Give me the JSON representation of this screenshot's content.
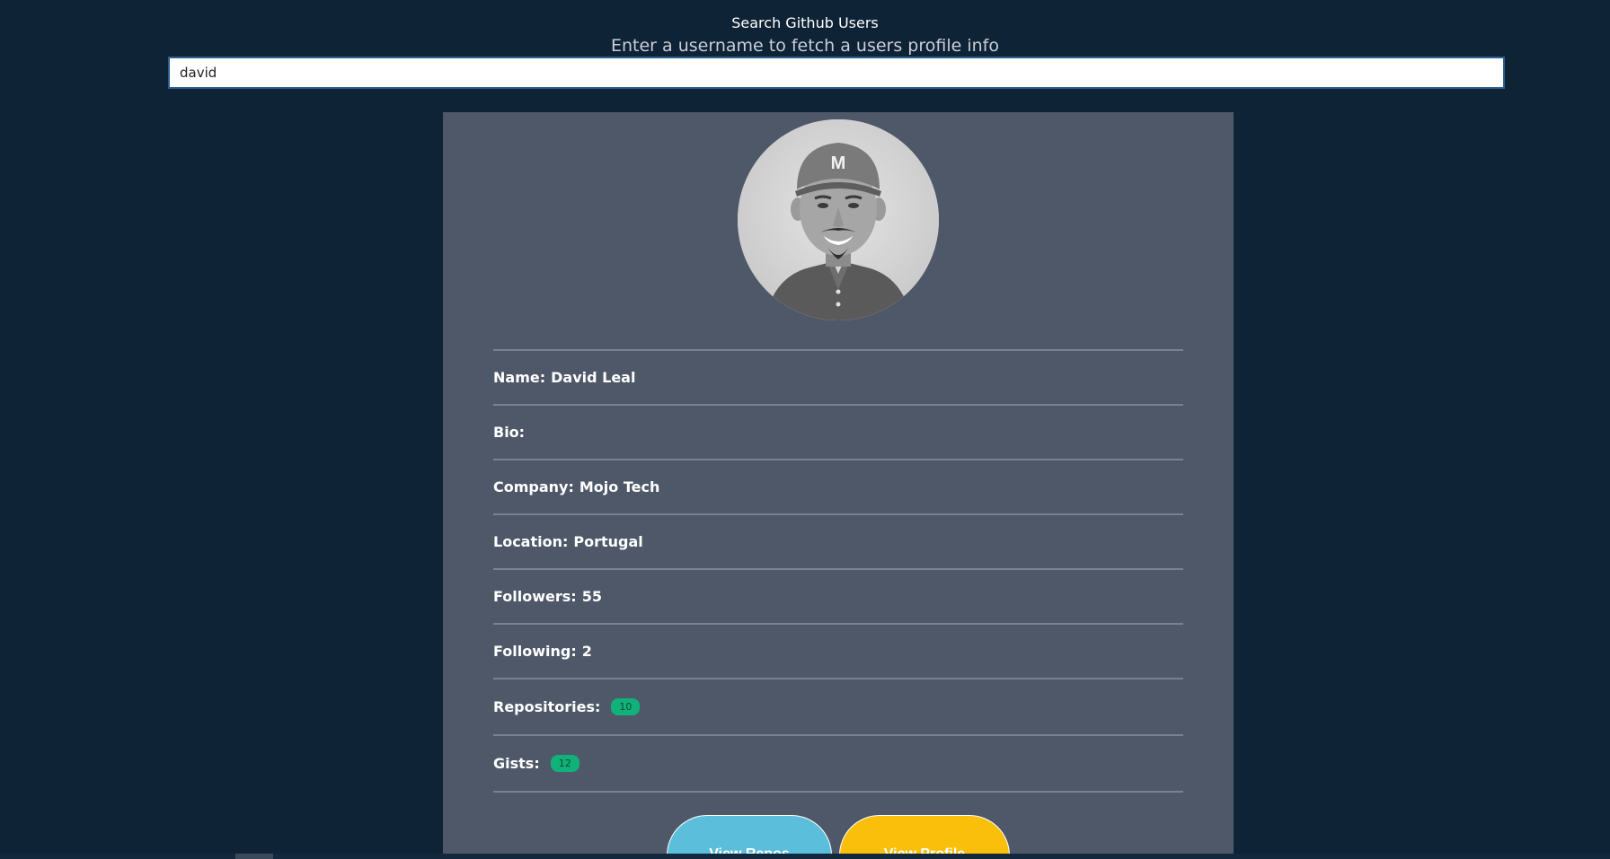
{
  "header": {
    "title": "Search Github Users",
    "subtitle": "Enter a username to fetch a users profile info"
  },
  "search": {
    "value": "david",
    "placeholder": ""
  },
  "profile": {
    "avatar_icon": "avatar-photo",
    "fields": [
      {
        "label": "Name:",
        "value": "David Leal"
      },
      {
        "label": "Bio:",
        "value": ""
      },
      {
        "label": "Company:",
        "value": "Mojo Tech"
      },
      {
        "label": "Location:",
        "value": "Portugal"
      },
      {
        "label": "Followers:",
        "value": "55"
      },
      {
        "label": "Following:",
        "value": "2"
      }
    ],
    "repositories": {
      "label": "Repositories:",
      "count": "10"
    },
    "gists": {
      "label": "Gists:",
      "count": "12"
    }
  },
  "actions": {
    "view_repos_label": "View Repos",
    "view_profile_label": "View Profile"
  },
  "colors": {
    "background": "#0f2336",
    "card": "#4e5868",
    "badge": "#10b27a",
    "repos_button": "#5bbfdc",
    "profile_button": "#f9bf0a"
  }
}
